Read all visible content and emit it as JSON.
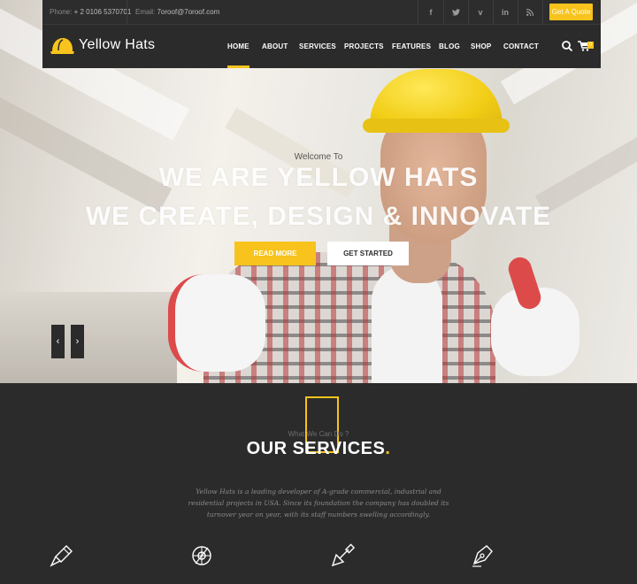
{
  "topbar": {
    "phone_label": "Phone:",
    "phone": "+ 2 0106 5370701",
    "email_label": "Email:",
    "email": "7oroof@7oroof.com",
    "social_icons": [
      "facebook-icon",
      "twitter-icon",
      "vimeo-icon",
      "linkedin-icon",
      "rss-icon"
    ],
    "quote_button": "Get A Quote"
  },
  "nav": {
    "logo_text": "Yellow Hats",
    "items": [
      "HOME",
      "ABOUT",
      "SERVICES",
      "PROJECTS",
      "FEATURES",
      "BLOG",
      "SHOP",
      "CONTACT"
    ],
    "active": "HOME",
    "cart_count": "0"
  },
  "hero": {
    "welcome": "Welcome To",
    "heading_1": "WE ARE YELLOW HATS",
    "heading_2": "WE CREATE, DESIGN & INNOVATE",
    "read_more": "READ MORE",
    "get_started": "GET STARTED",
    "prev_arrow": "‹",
    "next_arrow": "›"
  },
  "services": {
    "pre_title": "What We Can Do ?",
    "title": "OUR SERVICES",
    "title_dot": ".",
    "description": "Yellow Hats is a leading developer of A-grade commercial, industrial and residential projects in USA. Since its foundation the company has doubled its turnover year on year, with its staff numbers swelling accordingly.",
    "icons": [
      "paint-brush-icon",
      "globe-cog-icon",
      "trowel-icon",
      "pen-nib-icon"
    ]
  },
  "colors": {
    "accent": "#f7c31c",
    "dark": "#2b2b2b"
  }
}
